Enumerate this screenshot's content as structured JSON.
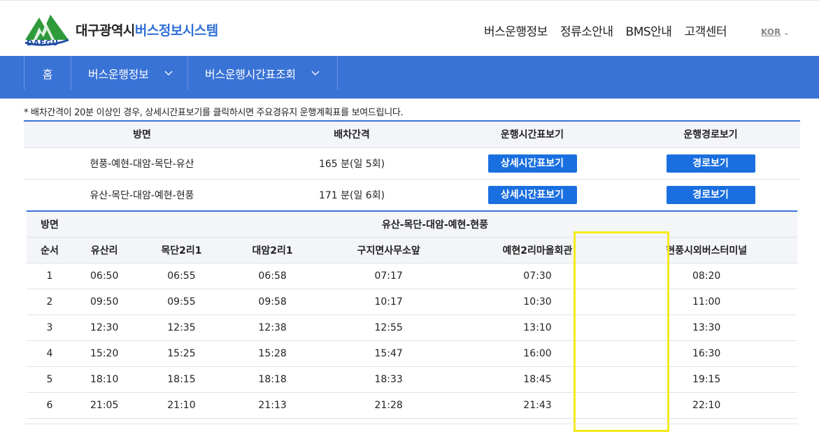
{
  "brand": {
    "logo_text": "DAEGU",
    "title_part1": "대구광역시",
    "title_part2": "버스정보시스템",
    "logo_color": "#2e9a3a",
    "accent_color": "#2f6fd8"
  },
  "top_nav": [
    "버스운행정보",
    "정류소안내",
    "BMS안내",
    "고객센터"
  ],
  "language": "KOR",
  "breadcrumb": {
    "home": "홈",
    "level1": "버스운행정보",
    "level2": "버스운행시간표조회"
  },
  "notice": "* 배차간격이 20분 이상인 경우, 상세시간표보기를 클릭하시면 주요경유지 운행계획표를 보여드립니다.",
  "route_table": {
    "headers": [
      "방면",
      "배차간격",
      "운행시간표보기",
      "운행경로보기"
    ],
    "rows": [
      {
        "direction": "현풍-예현-대암-목단-유산",
        "interval": "165 분(일 5회)",
        "timetable_btn": "상세시간표보기",
        "route_btn": "경로보기"
      },
      {
        "direction": "유산-목단-대암-예현-현풍",
        "interval": "171 분(일 6회)",
        "timetable_btn": "상세시간표보기",
        "route_btn": "경로보기"
      }
    ]
  },
  "schedule_table": {
    "direction_label": "방면",
    "direction_value": "유산-목단-대암-예현-현풍",
    "order_label": "순서",
    "stops": [
      "유산리",
      "목단2리1",
      "대암2리1",
      "구지면사무소앞",
      "예현2리마을회관",
      "현풍시외버스터미널"
    ],
    "rows": [
      {
        "n": "1",
        "times": [
          "06:50",
          "06:55",
          "06:58",
          "07:17",
          "07:30",
          "08:20"
        ]
      },
      {
        "n": "2",
        "times": [
          "09:50",
          "09:55",
          "09:58",
          "10:17",
          "10:30",
          "11:00"
        ]
      },
      {
        "n": "3",
        "times": [
          "12:30",
          "12:35",
          "12:38",
          "12:55",
          "13:10",
          "13:30"
        ]
      },
      {
        "n": "4",
        "times": [
          "15:20",
          "15:25",
          "15:28",
          "15:47",
          "16:00",
          "16:30"
        ]
      },
      {
        "n": "5",
        "times": [
          "18:10",
          "18:15",
          "18:18",
          "18:33",
          "18:45",
          "19:15"
        ]
      },
      {
        "n": "6",
        "times": [
          "21:05",
          "21:10",
          "21:13",
          "21:28",
          "21:43",
          "22:10"
        ]
      }
    ]
  }
}
